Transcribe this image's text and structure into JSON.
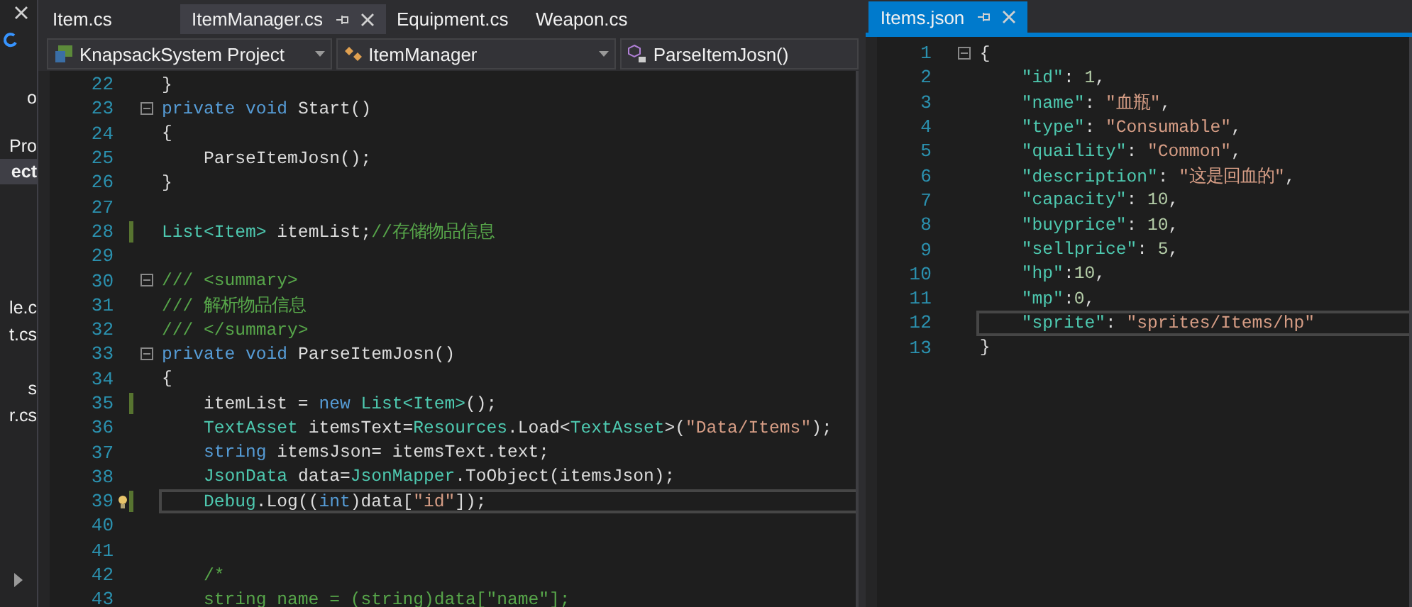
{
  "sidebar": {
    "items": [
      {
        "text": "o",
        "selected": false
      },
      {
        "text": "Pro",
        "selected": false
      },
      {
        "text": "ect",
        "selected": true
      },
      {
        "text": "le.c",
        "selected": false
      },
      {
        "text": "t.cs",
        "selected": false
      },
      {
        "text": "s",
        "selected": false
      },
      {
        "text": "r.cs",
        "selected": false
      }
    ]
  },
  "left_editor": {
    "tabs": [
      {
        "label": "Item.cs",
        "selected": false
      },
      {
        "label": "ItemManager.cs",
        "selected": true
      },
      {
        "label": "Equipment.cs",
        "selected": false
      },
      {
        "label": "Weapon.cs",
        "selected": false
      }
    ],
    "navigation": [
      "KnapsackSystem Project",
      "ItemManager",
      "ParseItemJosn()"
    ],
    "lines": [
      {
        "number": "22",
        "tokens": [
          {
            "kind": "p",
            "text": "}"
          }
        ]
      },
      {
        "number": "23",
        "fold": true,
        "tokens": [
          {
            "kind": "k",
            "text": "private void "
          },
          {
            "kind": "p",
            "text": "Start()"
          }
        ]
      },
      {
        "number": "24",
        "tokens": [
          {
            "kind": "p",
            "text": "{"
          }
        ]
      },
      {
        "number": "25",
        "tokens": [
          {
            "kind": "p",
            "text": "    ParseItemJosn();"
          }
        ]
      },
      {
        "number": "26",
        "tokens": [
          {
            "kind": "p",
            "text": "}"
          }
        ]
      },
      {
        "number": "27"
      },
      {
        "number": "28",
        "changed": true,
        "tokens": [
          {
            "kind": "t",
            "text": "List<Item>"
          },
          {
            "kind": "p",
            "text": " itemList;"
          },
          {
            "kind": "c",
            "text": "//存储物品信息"
          }
        ]
      },
      {
        "number": "29"
      },
      {
        "number": "30",
        "fold": true,
        "tokens": [
          {
            "kind": "c",
            "text": "/// <summary>"
          }
        ]
      },
      {
        "number": "31",
        "tokens": [
          {
            "kind": "c",
            "text": "/// 解析物品信息"
          }
        ]
      },
      {
        "number": "32",
        "tokens": [
          {
            "kind": "c",
            "text": "/// </summary>"
          }
        ]
      },
      {
        "number": "33",
        "fold": true,
        "tokens": [
          {
            "kind": "k",
            "text": "private void "
          },
          {
            "kind": "p",
            "text": "ParseItemJosn()"
          }
        ]
      },
      {
        "number": "34",
        "tokens": [
          {
            "kind": "p",
            "text": "{"
          }
        ]
      },
      {
        "number": "35",
        "changed": true,
        "tokens": [
          {
            "kind": "p",
            "text": "    itemList = "
          },
          {
            "kind": "k",
            "text": "new "
          },
          {
            "kind": "t",
            "text": "List<Item>"
          },
          {
            "kind": "p",
            "text": "();"
          }
        ]
      },
      {
        "number": "36",
        "tokens": [
          {
            "kind": "t",
            "text": "    TextAsset"
          },
          {
            "kind": "p",
            "text": " itemsText="
          },
          {
            "kind": "t",
            "text": "Resources"
          },
          {
            "kind": "p",
            "text": ".Load<"
          },
          {
            "kind": "t",
            "text": "TextAsset"
          },
          {
            "kind": "p",
            "text": ">("
          },
          {
            "kind": "s",
            "text": "\"Data/Items\""
          },
          {
            "kind": "p",
            "text": ");"
          }
        ]
      },
      {
        "number": "37",
        "tokens": [
          {
            "kind": "k",
            "text": "    string"
          },
          {
            "kind": "p",
            "text": " itemsJson= itemsText.text;"
          }
        ]
      },
      {
        "number": "38",
        "tokens": [
          {
            "kind": "t",
            "text": "    JsonData"
          },
          {
            "kind": "p",
            "text": " data="
          },
          {
            "kind": "t",
            "text": "JsonMapper"
          },
          {
            "kind": "p",
            "text": ".ToObject(itemsJson);"
          }
        ]
      },
      {
        "number": "39",
        "changed": true,
        "lightbulb": true,
        "current": true,
        "tokens": [
          {
            "kind": "t",
            "text": "    Debug"
          },
          {
            "kind": "p",
            "text": ".Log(("
          },
          {
            "kind": "k",
            "text": "int"
          },
          {
            "kind": "p",
            "text": ")data["
          },
          {
            "kind": "s",
            "text": "\"id\""
          },
          {
            "kind": "p",
            "text": "]);"
          }
        ]
      },
      {
        "number": "40"
      },
      {
        "number": "41"
      },
      {
        "number": "42",
        "tokens": [
          {
            "kind": "c",
            "text": "    /*"
          }
        ]
      },
      {
        "number": "43",
        "tokens": [
          {
            "kind": "c",
            "text": "    string name = (string)data[\"name\"];"
          }
        ]
      }
    ]
  },
  "right_editor": {
    "tabs": [
      {
        "label": "Items.json",
        "selected": true
      }
    ],
    "lines": [
      {
        "number": "1",
        "fold": true,
        "tokens": [
          {
            "kind": "p",
            "text": "{"
          }
        ]
      },
      {
        "number": "2",
        "tokens": [
          {
            "kind": "j",
            "text": "    \"id\""
          },
          {
            "kind": "p",
            "text": ": "
          },
          {
            "kind": "n",
            "text": "1"
          },
          {
            "kind": "p",
            "text": ","
          }
        ]
      },
      {
        "number": "3",
        "tokens": [
          {
            "kind": "j",
            "text": "    \"name\""
          },
          {
            "kind": "p",
            "text": ": "
          },
          {
            "kind": "s",
            "text": "\"血瓶\""
          },
          {
            "kind": "p",
            "text": ","
          }
        ]
      },
      {
        "number": "4",
        "tokens": [
          {
            "kind": "j",
            "text": "    \"type\""
          },
          {
            "kind": "p",
            "text": ": "
          },
          {
            "kind": "s",
            "text": "\"Consumable\""
          },
          {
            "kind": "p",
            "text": ","
          }
        ]
      },
      {
        "number": "5",
        "tokens": [
          {
            "kind": "j",
            "text": "    \"quaility\""
          },
          {
            "kind": "p",
            "text": ": "
          },
          {
            "kind": "s",
            "text": "\"Common\""
          },
          {
            "kind": "p",
            "text": ","
          }
        ]
      },
      {
        "number": "6",
        "tokens": [
          {
            "kind": "j",
            "text": "    \"description\""
          },
          {
            "kind": "p",
            "text": ": "
          },
          {
            "kind": "s",
            "text": "\"这是回血的\""
          },
          {
            "kind": "p",
            "text": ","
          }
        ]
      },
      {
        "number": "7",
        "tokens": [
          {
            "kind": "j",
            "text": "    \"capacity\""
          },
          {
            "kind": "p",
            "text": ": "
          },
          {
            "kind": "n",
            "text": "10"
          },
          {
            "kind": "p",
            "text": ","
          }
        ]
      },
      {
        "number": "8",
        "tokens": [
          {
            "kind": "j",
            "text": "    \"buyprice\""
          },
          {
            "kind": "p",
            "text": ": "
          },
          {
            "kind": "n",
            "text": "10"
          },
          {
            "kind": "p",
            "text": ","
          }
        ]
      },
      {
        "number": "9",
        "tokens": [
          {
            "kind": "j",
            "text": "    \"sellprice\""
          },
          {
            "kind": "p",
            "text": ": "
          },
          {
            "kind": "n",
            "text": "5"
          },
          {
            "kind": "p",
            "text": ","
          }
        ]
      },
      {
        "number": "10",
        "tokens": [
          {
            "kind": "j",
            "text": "    \"hp\""
          },
          {
            "kind": "p",
            "text": ":"
          },
          {
            "kind": "n",
            "text": "10"
          },
          {
            "kind": "p",
            "text": ","
          }
        ]
      },
      {
        "number": "11",
        "tokens": [
          {
            "kind": "j",
            "text": "    \"mp\""
          },
          {
            "kind": "p",
            "text": ":"
          },
          {
            "kind": "n",
            "text": "0"
          },
          {
            "kind": "p",
            "text": ","
          }
        ]
      },
      {
        "number": "12",
        "current": true,
        "tokens": [
          {
            "kind": "j",
            "text": "    \"sprite\""
          },
          {
            "kind": "p",
            "text": ": "
          },
          {
            "kind": "s",
            "text": "\"sprites/Items/hp\""
          }
        ]
      },
      {
        "number": "13",
        "tokens": [
          {
            "kind": "p",
            "text": "}"
          }
        ]
      }
    ]
  }
}
